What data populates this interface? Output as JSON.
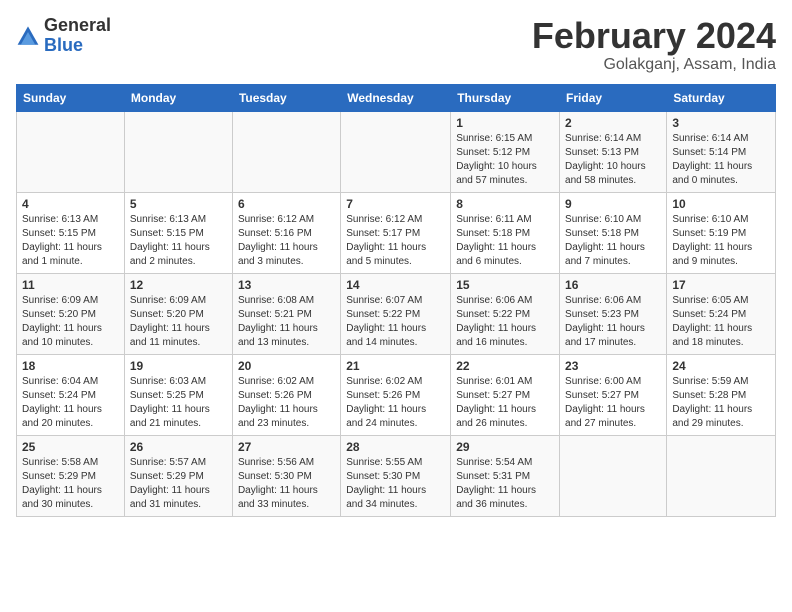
{
  "header": {
    "logo_general": "General",
    "logo_blue": "Blue",
    "month_title": "February 2024",
    "location": "Golakganj, Assam, India"
  },
  "calendar": {
    "days_of_week": [
      "Sunday",
      "Monday",
      "Tuesday",
      "Wednesday",
      "Thursday",
      "Friday",
      "Saturday"
    ],
    "weeks": [
      [
        {
          "day": "",
          "info": ""
        },
        {
          "day": "",
          "info": ""
        },
        {
          "day": "",
          "info": ""
        },
        {
          "day": "",
          "info": ""
        },
        {
          "day": "1",
          "info": "Sunrise: 6:15 AM\nSunset: 5:12 PM\nDaylight: 10 hours and 57 minutes."
        },
        {
          "day": "2",
          "info": "Sunrise: 6:14 AM\nSunset: 5:13 PM\nDaylight: 10 hours and 58 minutes."
        },
        {
          "day": "3",
          "info": "Sunrise: 6:14 AM\nSunset: 5:14 PM\nDaylight: 11 hours and 0 minutes."
        }
      ],
      [
        {
          "day": "4",
          "info": "Sunrise: 6:13 AM\nSunset: 5:15 PM\nDaylight: 11 hours and 1 minute."
        },
        {
          "day": "5",
          "info": "Sunrise: 6:13 AM\nSunset: 5:15 PM\nDaylight: 11 hours and 2 minutes."
        },
        {
          "day": "6",
          "info": "Sunrise: 6:12 AM\nSunset: 5:16 PM\nDaylight: 11 hours and 3 minutes."
        },
        {
          "day": "7",
          "info": "Sunrise: 6:12 AM\nSunset: 5:17 PM\nDaylight: 11 hours and 5 minutes."
        },
        {
          "day": "8",
          "info": "Sunrise: 6:11 AM\nSunset: 5:18 PM\nDaylight: 11 hours and 6 minutes."
        },
        {
          "day": "9",
          "info": "Sunrise: 6:10 AM\nSunset: 5:18 PM\nDaylight: 11 hours and 7 minutes."
        },
        {
          "day": "10",
          "info": "Sunrise: 6:10 AM\nSunset: 5:19 PM\nDaylight: 11 hours and 9 minutes."
        }
      ],
      [
        {
          "day": "11",
          "info": "Sunrise: 6:09 AM\nSunset: 5:20 PM\nDaylight: 11 hours and 10 minutes."
        },
        {
          "day": "12",
          "info": "Sunrise: 6:09 AM\nSunset: 5:20 PM\nDaylight: 11 hours and 11 minutes."
        },
        {
          "day": "13",
          "info": "Sunrise: 6:08 AM\nSunset: 5:21 PM\nDaylight: 11 hours and 13 minutes."
        },
        {
          "day": "14",
          "info": "Sunrise: 6:07 AM\nSunset: 5:22 PM\nDaylight: 11 hours and 14 minutes."
        },
        {
          "day": "15",
          "info": "Sunrise: 6:06 AM\nSunset: 5:22 PM\nDaylight: 11 hours and 16 minutes."
        },
        {
          "day": "16",
          "info": "Sunrise: 6:06 AM\nSunset: 5:23 PM\nDaylight: 11 hours and 17 minutes."
        },
        {
          "day": "17",
          "info": "Sunrise: 6:05 AM\nSunset: 5:24 PM\nDaylight: 11 hours and 18 minutes."
        }
      ],
      [
        {
          "day": "18",
          "info": "Sunrise: 6:04 AM\nSunset: 5:24 PM\nDaylight: 11 hours and 20 minutes."
        },
        {
          "day": "19",
          "info": "Sunrise: 6:03 AM\nSunset: 5:25 PM\nDaylight: 11 hours and 21 minutes."
        },
        {
          "day": "20",
          "info": "Sunrise: 6:02 AM\nSunset: 5:26 PM\nDaylight: 11 hours and 23 minutes."
        },
        {
          "day": "21",
          "info": "Sunrise: 6:02 AM\nSunset: 5:26 PM\nDaylight: 11 hours and 24 minutes."
        },
        {
          "day": "22",
          "info": "Sunrise: 6:01 AM\nSunset: 5:27 PM\nDaylight: 11 hours and 26 minutes."
        },
        {
          "day": "23",
          "info": "Sunrise: 6:00 AM\nSunset: 5:27 PM\nDaylight: 11 hours and 27 minutes."
        },
        {
          "day": "24",
          "info": "Sunrise: 5:59 AM\nSunset: 5:28 PM\nDaylight: 11 hours and 29 minutes."
        }
      ],
      [
        {
          "day": "25",
          "info": "Sunrise: 5:58 AM\nSunset: 5:29 PM\nDaylight: 11 hours and 30 minutes."
        },
        {
          "day": "26",
          "info": "Sunrise: 5:57 AM\nSunset: 5:29 PM\nDaylight: 11 hours and 31 minutes."
        },
        {
          "day": "27",
          "info": "Sunrise: 5:56 AM\nSunset: 5:30 PM\nDaylight: 11 hours and 33 minutes."
        },
        {
          "day": "28",
          "info": "Sunrise: 5:55 AM\nSunset: 5:30 PM\nDaylight: 11 hours and 34 minutes."
        },
        {
          "day": "29",
          "info": "Sunrise: 5:54 AM\nSunset: 5:31 PM\nDaylight: 11 hours and 36 minutes."
        },
        {
          "day": "",
          "info": ""
        },
        {
          "day": "",
          "info": ""
        }
      ]
    ]
  }
}
